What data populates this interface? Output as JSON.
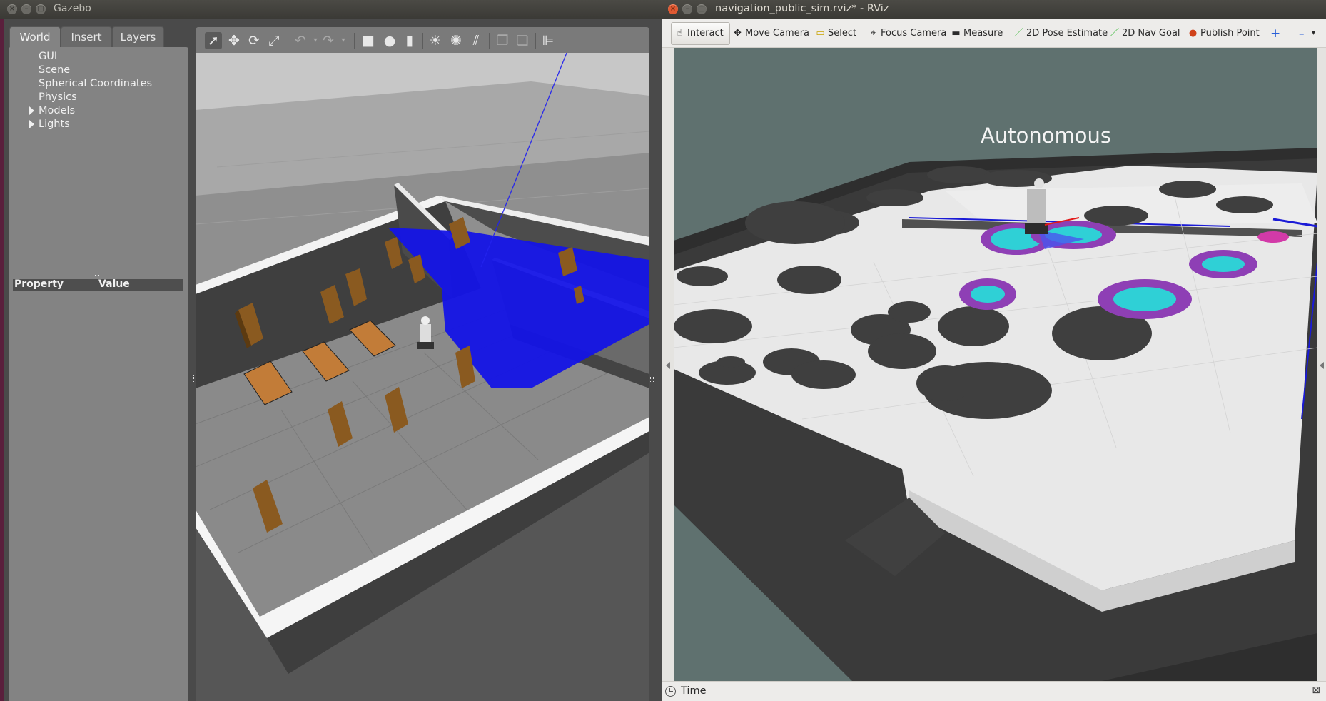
{
  "gazebo": {
    "title": "Gazebo",
    "tabs": [
      "World",
      "Insert",
      "Layers"
    ],
    "tree": [
      "GUI",
      "Scene",
      "Spherical Coordinates",
      "Physics",
      "Models",
      "Lights"
    ],
    "property_header": "Property",
    "value_header": "Value"
  },
  "rviz": {
    "title": "navigation_public_sim.rviz* - RViz",
    "tools": [
      "Interact",
      "Move Camera",
      "Select",
      "Focus Camera",
      "Measure",
      "2D Pose Estimate",
      "2D Nav Goal",
      "Publish Point"
    ],
    "overlay_text": "Autonomous",
    "status_label": "Time"
  },
  "colors": {
    "accent_close": "#e05a33",
    "laser_blue": "#1414e6",
    "costmap_cyan": "#2fd0d6",
    "costmap_purple": "#8e3fb5"
  }
}
